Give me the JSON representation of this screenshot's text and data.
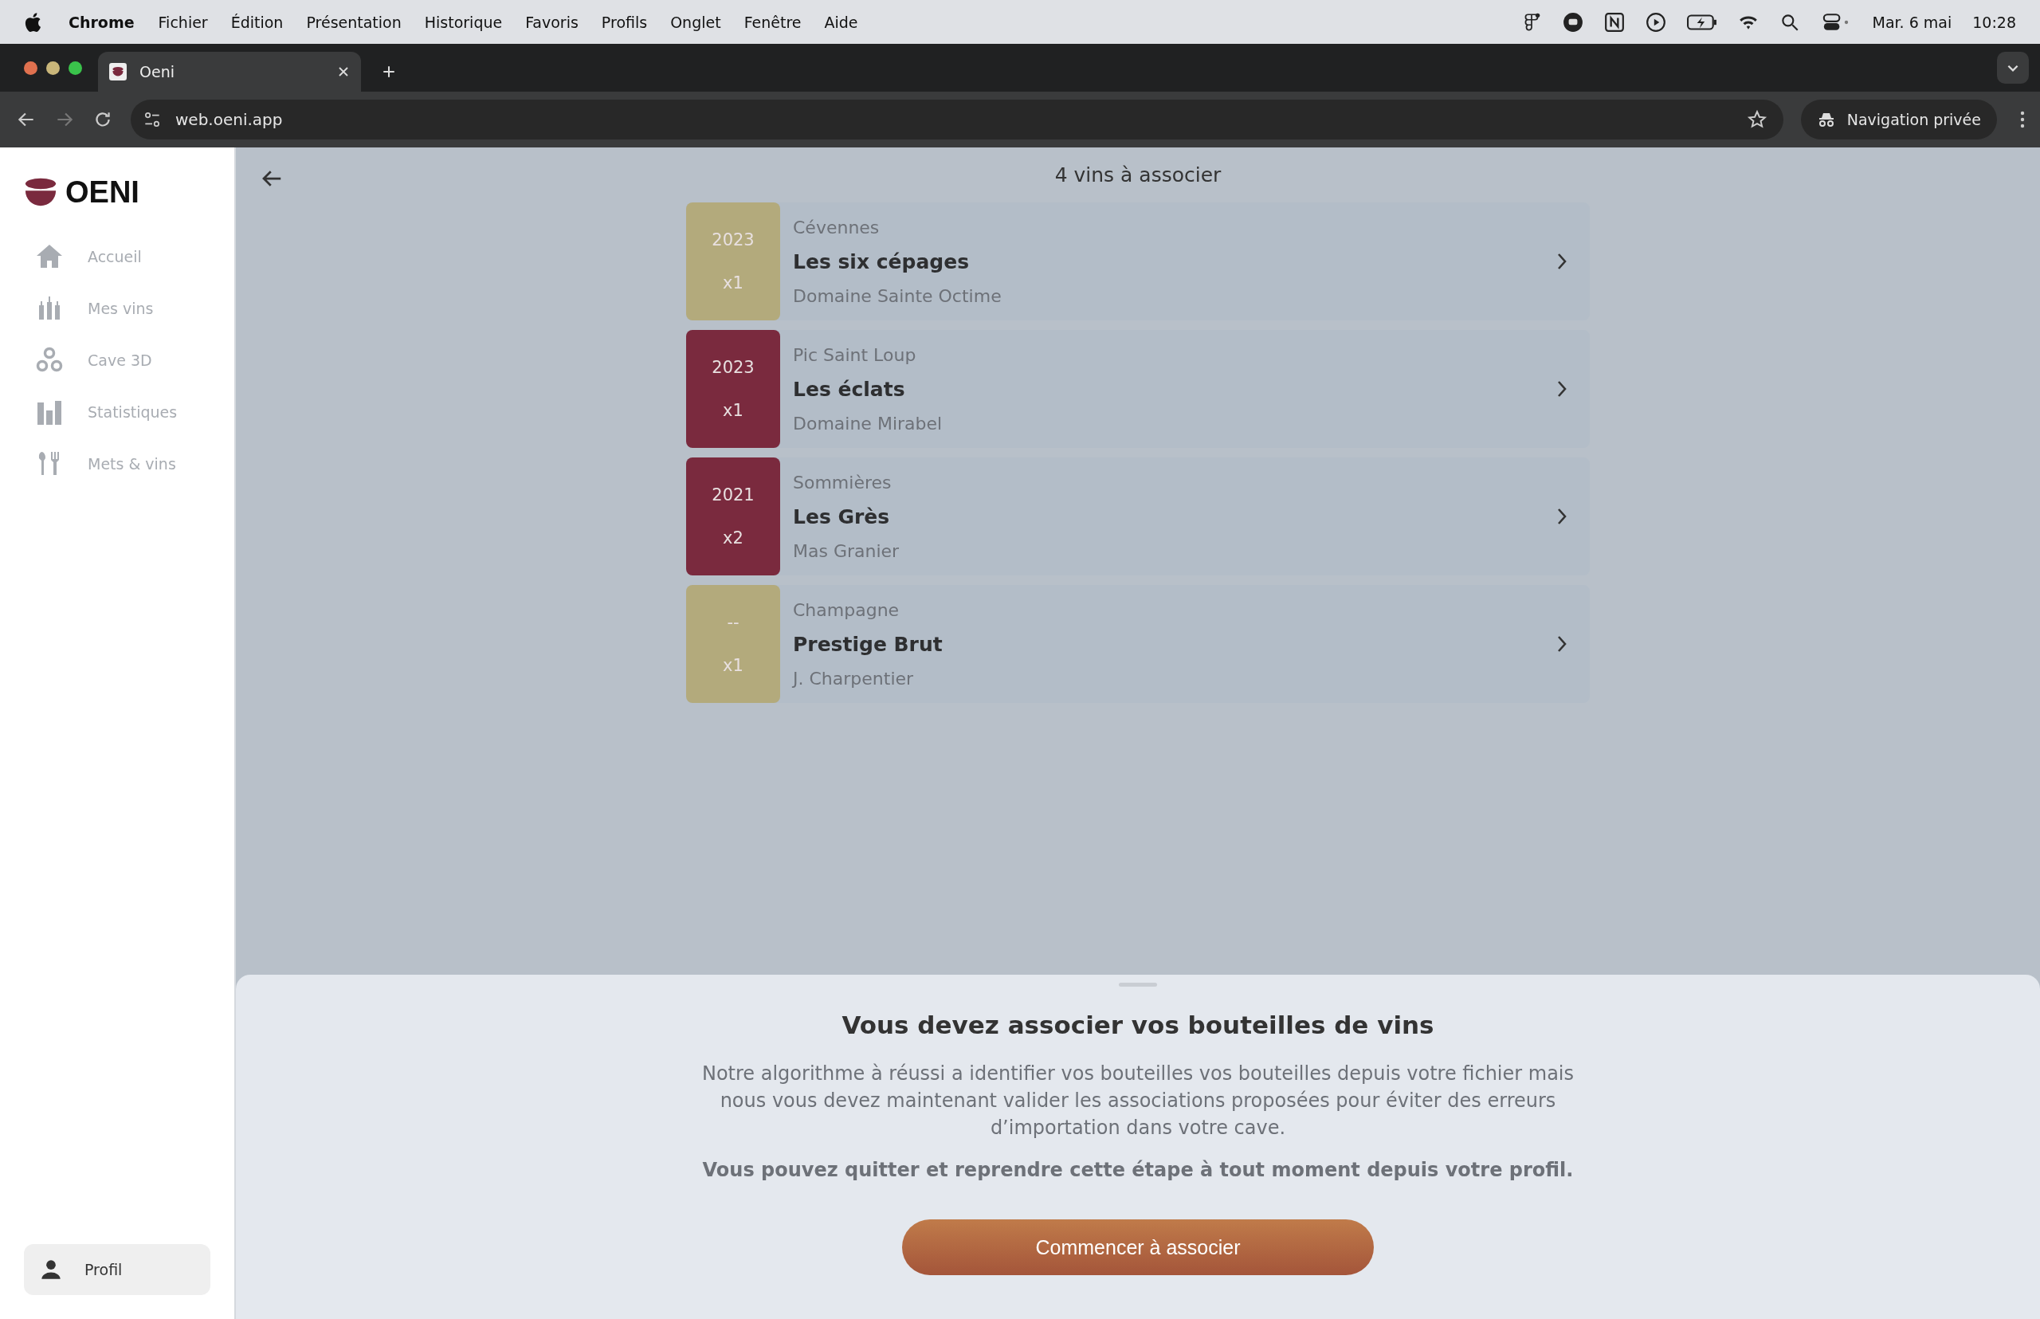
{
  "menu_bar": {
    "app": "Chrome",
    "items": [
      "Fichier",
      "Édition",
      "Présentation",
      "Historique",
      "Favoris",
      "Profils",
      "Onglet",
      "Fenêtre",
      "Aide"
    ],
    "date": "Mar. 6 mai",
    "time": "10:28"
  },
  "browser": {
    "tab": {
      "title": "Oeni",
      "selected": true
    },
    "url": "web.oeni.app",
    "private_label": "Navigation privée"
  },
  "sidebar": {
    "logo": "OENI",
    "items": [
      {
        "label": "Accueil",
        "kind": "home",
        "selected": false
      },
      {
        "label": "Mes vins",
        "kind": "bottles",
        "selected": false
      },
      {
        "label": "Cave 3D",
        "kind": "circles",
        "selected": false
      },
      {
        "label": "Statistiques",
        "kind": "bars",
        "selected": false
      },
      {
        "label": "Mets & vins",
        "kind": "cutlery",
        "selected": false
      }
    ],
    "profile": "Profil"
  },
  "page": {
    "title": "4 vins à associer",
    "wines": [
      {
        "vintage": "2023",
        "quantity": "x1",
        "region": "Cévennes",
        "name": "Les six cépages",
        "producer": "Domaine Sainte Octime",
        "color": "#b3aa7c"
      },
      {
        "vintage": "2023",
        "quantity": "x1",
        "region": "Pic Saint Loup",
        "name": "Les éclats",
        "producer": "Domaine Mirabel",
        "color": "#7a2a3e"
      },
      {
        "vintage": "2021",
        "quantity": "x2",
        "region": "Sommières",
        "name": "Les Grès",
        "producer": "Mas Granier",
        "color": "#7a2a3e"
      },
      {
        "vintage": "--",
        "quantity": "x1",
        "region": "Champagne",
        "name": "Prestige Brut",
        "producer": "J. Charpentier",
        "color": "#b3aa7c"
      }
    ]
  },
  "sheet": {
    "title": "Vous devez associer vos bouteilles de vins",
    "body": "Notre algorithme à réussi a identifier vos bouteilles vos bouteilles depuis votre fichier mais nous vous devez maintenant valider les associations proposées pour éviter des erreurs d’importation dans votre cave.",
    "note": "Vous pouvez quitter et reprendre cette étape à tout moment depuis votre profil.",
    "button": "Commencer à associer"
  }
}
